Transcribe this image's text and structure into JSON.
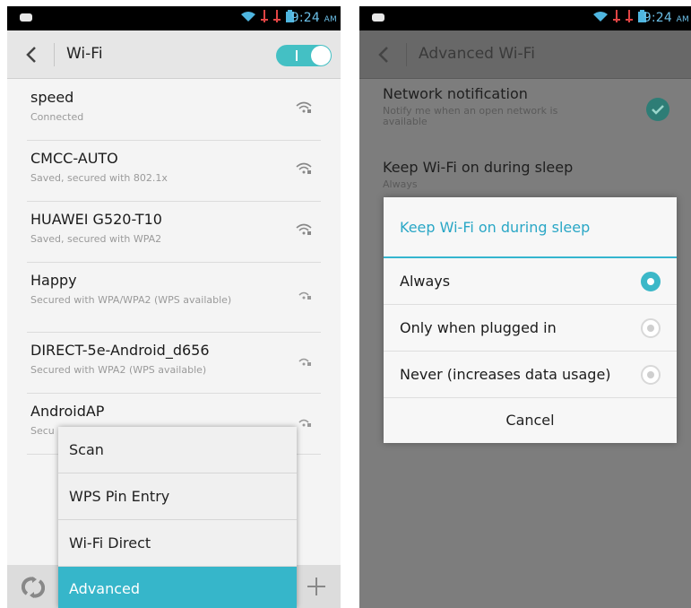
{
  "left": {
    "status": {
      "time": "9:24",
      "ampm": "AM"
    },
    "header": {
      "title": "Wi-Fi",
      "toggle_state": "on"
    },
    "networks": [
      {
        "name": "speed",
        "status": "Connected"
      },
      {
        "name": "CMCC-AUTO",
        "status": "Saved, secured with 802.1x"
      },
      {
        "name": "HUAWEI G520-T10",
        "status": "Saved, secured with WPA2"
      },
      {
        "name": "Happy",
        "status": "Secured with WPA/WPA2 (WPS available)"
      },
      {
        "name": "DIRECT-5e-Android_d656",
        "status": "Secured with WPA2 (WPS available)"
      },
      {
        "name": "AndroidAP",
        "status": "Secu"
      }
    ],
    "menu": {
      "items": [
        "Scan",
        "WPS Pin Entry",
        "Wi-Fi Direct",
        "Advanced"
      ],
      "selected": "Advanced"
    }
  },
  "right": {
    "status": {
      "time": "9:24",
      "ampm": "AM"
    },
    "header": {
      "title": "Advanced Wi-Fi"
    },
    "settings": {
      "network_notification": {
        "title": "Network notification",
        "desc": "Notify me when an open network is available",
        "checked": true
      },
      "keep_wifi": {
        "title": "Keep Wi-Fi on during sleep",
        "value": "Always"
      }
    },
    "dialog": {
      "title": "Keep Wi-Fi on during sleep",
      "options": [
        "Always",
        "Only when plugged in",
        "Never (increases data usage)"
      ],
      "selected": "Always",
      "cancel": "Cancel"
    }
  },
  "colors": {
    "accent": "#36b6ca",
    "check": "#2e7d76"
  }
}
